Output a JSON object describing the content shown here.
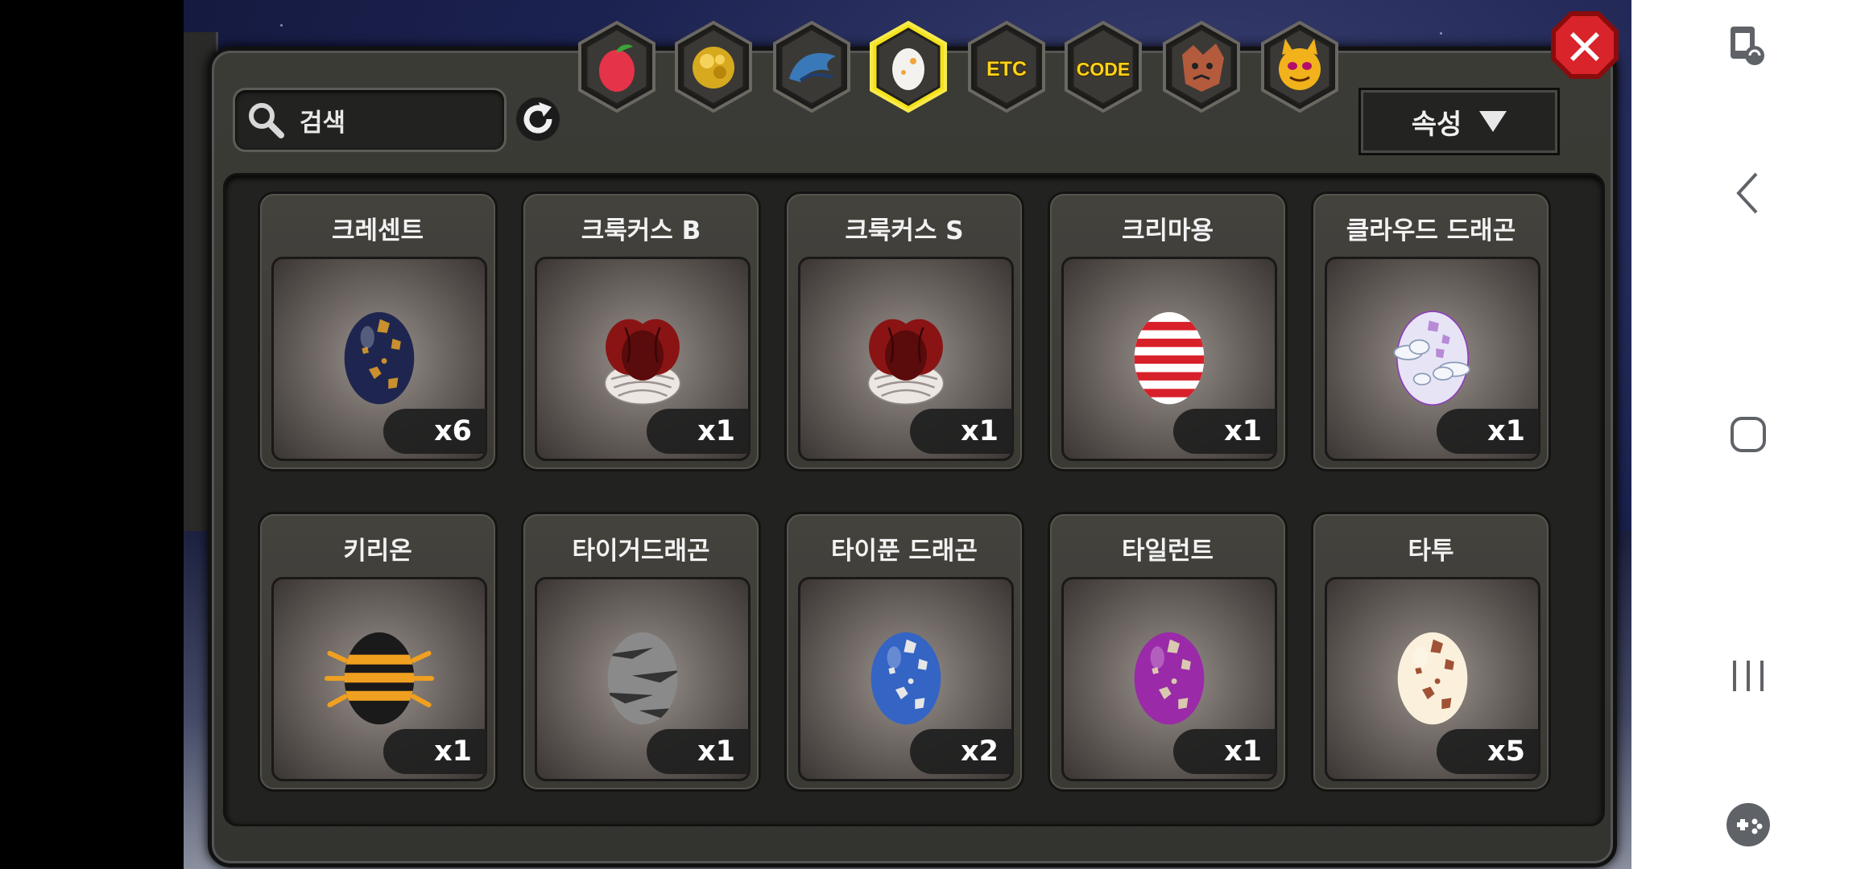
{
  "search": {
    "placeholder": "검색"
  },
  "sort": {
    "label": "속성"
  },
  "tabs": [
    {
      "name": "fruit",
      "icon": "fruit-icon",
      "selected": false
    },
    {
      "name": "gold",
      "icon": "gold-ore-icon",
      "selected": false
    },
    {
      "name": "dragon",
      "icon": "dragon-icon",
      "selected": false
    },
    {
      "name": "egg",
      "icon": "egg-icon",
      "selected": true
    },
    {
      "name": "etc",
      "label": "ETC",
      "selected": false
    },
    {
      "name": "code",
      "label": "CODE",
      "selected": false
    },
    {
      "name": "beast",
      "icon": "wolf-icon",
      "selected": false
    },
    {
      "name": "devil",
      "icon": "devil-face-icon",
      "selected": false
    }
  ],
  "items": [
    {
      "name": "크레센트",
      "qty": "x6",
      "egg": {
        "base": "#1e2650",
        "spot": "#c9902e",
        "style": "spots"
      }
    },
    {
      "name": "크룩커스 B",
      "qty": "x1",
      "egg": {
        "base": "#8a1414",
        "spot": "#e7e0dc",
        "style": "cocoon"
      }
    },
    {
      "name": "크룩커스 S",
      "qty": "x1",
      "egg": {
        "base": "#8a1414",
        "spot": "#e7e0dc",
        "style": "cocoon"
      }
    },
    {
      "name": "크리마용",
      "qty": "x1",
      "egg": {
        "base": "#ffffff",
        "spot": "#d8202a",
        "style": "stripes"
      }
    },
    {
      "name": "클라우드 드래곤",
      "qty": "x1",
      "egg": {
        "base": "#e7e4f6",
        "spot": "#b78ad6",
        "style": "cloud"
      }
    },
    {
      "name": "키리온",
      "qty": "x1",
      "egg": {
        "base": "#1a1a1a",
        "spot": "#f0a020",
        "style": "bee"
      }
    },
    {
      "name": "타이거드래곤",
      "qty": "x1",
      "egg": {
        "base": "#8a8a8a",
        "spot": "#333333",
        "style": "tiger"
      }
    },
    {
      "name": "타이푼 드래곤",
      "qty": "x2",
      "egg": {
        "base": "#3464c4",
        "spot": "#e6e6e6",
        "style": "spots"
      }
    },
    {
      "name": "타일런트",
      "qty": "x1",
      "egg": {
        "base": "#9a2aa8",
        "spot": "#d9c9b0",
        "style": "spots"
      }
    },
    {
      "name": "타투",
      "qty": "x5",
      "egg": {
        "base": "#fbf0dc",
        "spot": "#a05236",
        "style": "spots"
      }
    }
  ]
}
